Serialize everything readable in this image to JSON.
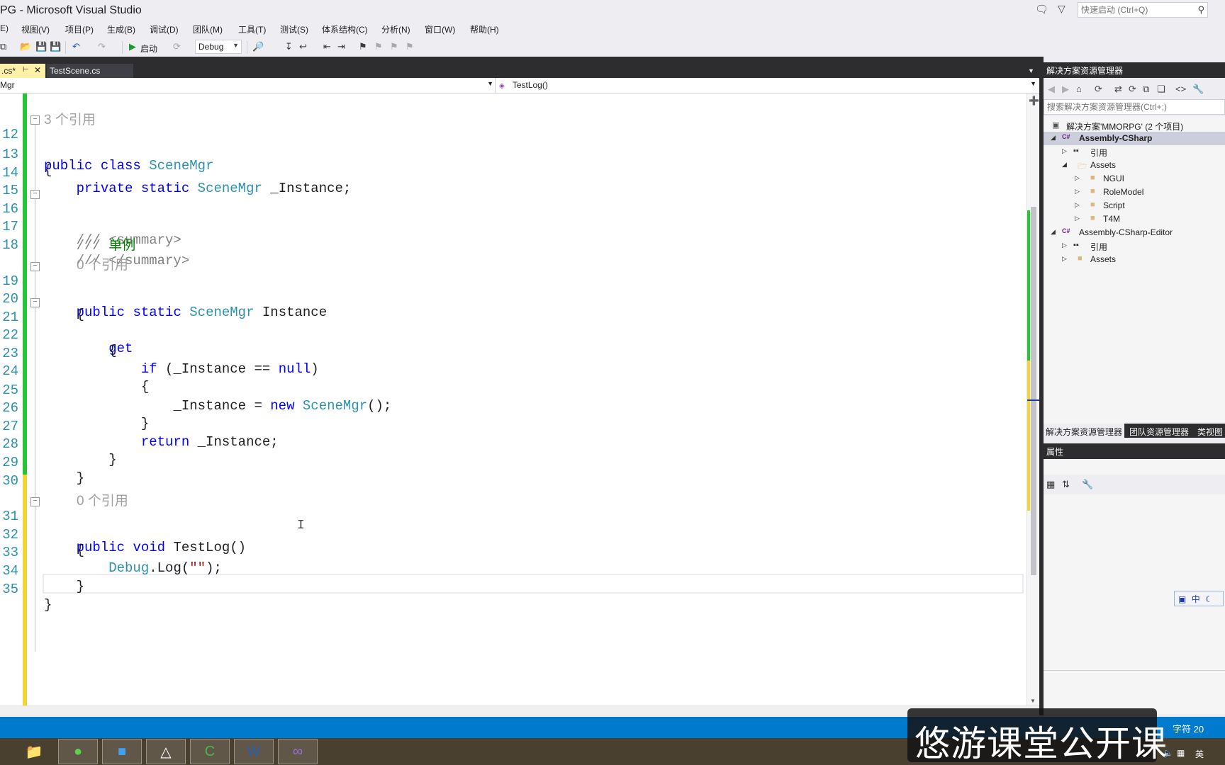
{
  "window": {
    "title": "PG - Microsoft Visual Studio",
    "quick_launch_placeholder": "快速启动 (Ctrl+Q)"
  },
  "menu": [
    "E)",
    "视图(V)",
    "项目(P)",
    "生成(B)",
    "调试(D)",
    "团队(M)",
    "工具(T)",
    "测试(S)",
    "体系结构(C)",
    "分析(N)",
    "窗口(W)",
    "帮助(H)"
  ],
  "toolbar": {
    "start_label": "启动",
    "configuration": "Debug"
  },
  "tabs": {
    "active": ".cs*",
    "inactive": "TestScene.cs"
  },
  "navbar": {
    "left": "Mgr",
    "right": "TestLog()"
  },
  "editor": {
    "lens": {
      "class_refs": "3 个引用",
      "instance_refs": "0 个引用",
      "testlog_refs": "0 个引用"
    },
    "lines": [
      {
        "n": "12",
        "parts": [
          [
            "kw",
            "public"
          ],
          [
            "",
            "  "
          ],
          [
            "kw",
            "class"
          ],
          [
            "",
            ""
          ],
          [
            "ty",
            "SceneMgr"
          ]
        ]
      },
      {
        "n": "13"
      },
      {
        "n": "14"
      },
      {
        "n": "15"
      },
      {
        "n": "16"
      },
      {
        "n": "17"
      },
      {
        "n": "18"
      },
      {
        "n": "19"
      },
      {
        "n": "20"
      },
      {
        "n": "21"
      },
      {
        "n": "22"
      },
      {
        "n": "23"
      },
      {
        "n": "24"
      },
      {
        "n": "25"
      },
      {
        "n": "26"
      },
      {
        "n": "27"
      },
      {
        "n": "28"
      },
      {
        "n": "29"
      },
      {
        "n": "30"
      },
      {
        "n": "31"
      },
      {
        "n": "32"
      },
      {
        "n": "33"
      },
      {
        "n": "34"
      },
      {
        "n": "35"
      }
    ],
    "text": {
      "public": "public",
      "class": "class",
      "private": "private",
      "static": "static",
      "void": "void",
      "get": "get",
      "if": "if",
      "null": "null",
      "new": "new",
      "return": "return",
      "scenemgr": "SceneMgr",
      "instance_field": "_Instance",
      "instance_prop": "Instance",
      "testlog": "TestLog",
      "debug": "Debug",
      "log": "Log",
      "summary_open": "/// <summary>",
      "summary_body_prefix": "/// ",
      "summary_body": "单例",
      "summary_close": "/// </summary>"
    }
  },
  "solution_explorer": {
    "title": "解决方案资源管理器",
    "search_placeholder": "搜索解决方案资源管理器(Ctrl+;)",
    "nodes": [
      {
        "label": "解决方案'MMORPG' (2 个项目)"
      },
      {
        "label": "Assembly-CSharp"
      },
      {
        "label": "引用"
      },
      {
        "label": "Assets"
      },
      {
        "label": "NGUI"
      },
      {
        "label": "RoleModel"
      },
      {
        "label": "Script"
      },
      {
        "label": "T4M"
      },
      {
        "label": "Assembly-CSharp-Editor"
      },
      {
        "label": "引用"
      },
      {
        "label": "Assets"
      }
    ],
    "bottom_tabs": [
      "解决方案资源管理器",
      "团队资源管理器",
      "类视图"
    ]
  },
  "properties": {
    "title": "属性"
  },
  "ime": {
    "label": "中"
  },
  "status": {
    "chars": "字符 20"
  },
  "tray": {
    "lang": "英"
  },
  "watermark": "悠游课堂公开课",
  "colors": {
    "keyword": "#0000ff",
    "type": "#2b91af",
    "comment": "#808080",
    "status_bar": "#007acc",
    "changed_saved": "#27c536",
    "changed_unsaved": "#f2d638"
  }
}
